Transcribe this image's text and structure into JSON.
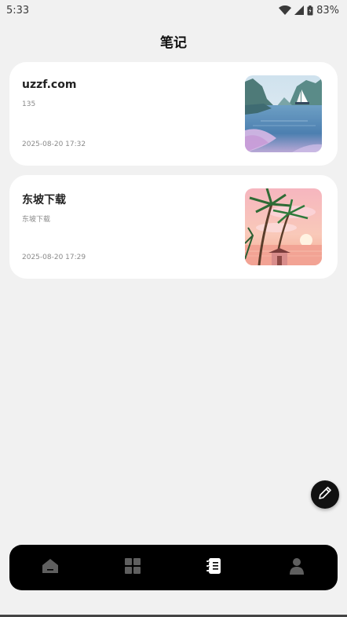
{
  "status": {
    "time": "5:33",
    "battery": "83%"
  },
  "header": {
    "title": "笔记"
  },
  "notes": [
    {
      "title": "uzzf.com",
      "body": "135",
      "date": "2025-08-20 17:32",
      "thumbnail": "lake-sailboat-painting"
    },
    {
      "title": "东坡下载",
      "body": "东坡下载",
      "date": "2025-08-20 17:29",
      "thumbnail": "palm-sunset-painting"
    }
  ],
  "fab": {
    "icon": "pencil-icon"
  },
  "nav": {
    "items": [
      {
        "icon": "home-icon",
        "active": false
      },
      {
        "icon": "grid-icon",
        "active": false
      },
      {
        "icon": "notebook-icon",
        "active": true
      },
      {
        "icon": "person-icon",
        "active": false
      }
    ]
  },
  "colors": {
    "background": "#f1f1f1",
    "card": "#ffffff",
    "nav": "#000000",
    "nav_inactive": "#5f5f5f",
    "nav_active": "#ffffff"
  }
}
